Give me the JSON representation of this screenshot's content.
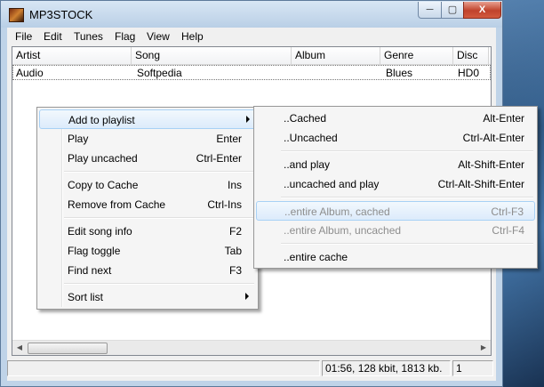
{
  "window": {
    "title": "MP3STOCK"
  },
  "caption_buttons": {
    "minimize": "─",
    "maximize": "▢",
    "close": "X"
  },
  "menubar": [
    "File",
    "Edit",
    "Tunes",
    "Flag",
    "View",
    "Help"
  ],
  "columns": [
    "Artist",
    "Song",
    "Album",
    "Genre",
    "Disc"
  ],
  "rows": [
    {
      "artist": "Audio",
      "song": "Softpedia",
      "album": "",
      "genre": "Blues",
      "disc": "HD0"
    }
  ],
  "context_menu": [
    {
      "label": "Add to playlist",
      "shortcut": "",
      "submenu": true,
      "highlighted": true
    },
    {
      "label": "Play",
      "shortcut": "Enter"
    },
    {
      "label": "Play uncached",
      "shortcut": "Ctrl-Enter"
    },
    {
      "label": "Copy to Cache",
      "shortcut": "Ins"
    },
    {
      "label": "Remove from Cache",
      "shortcut": "Ctrl-Ins"
    },
    {
      "label": "Edit song info",
      "shortcut": "F2"
    },
    {
      "label": "Flag toggle",
      "shortcut": "Tab"
    },
    {
      "label": "Find next",
      "shortcut": "F3"
    },
    {
      "label": "Sort list",
      "shortcut": "",
      "submenu": true
    }
  ],
  "submenu": [
    {
      "label": "..Cached",
      "shortcut": "Alt-Enter"
    },
    {
      "label": "..Uncached",
      "shortcut": "Ctrl-Alt-Enter"
    },
    {
      "label": "..and play",
      "shortcut": "Alt-Shift-Enter"
    },
    {
      "label": "..uncached and play",
      "shortcut": "Ctrl-Alt-Shift-Enter"
    },
    {
      "label": "..entire Album, cached",
      "shortcut": "Ctrl-F3",
      "disabled": true,
      "highlighted": true
    },
    {
      "label": "..entire Album, uncached",
      "shortcut": "Ctrl-F4",
      "disabled": true
    },
    {
      "label": "..entire cache",
      "shortcut": ""
    }
  ],
  "status": {
    "info": "01:56, 128 kbit, 1813 kb.",
    "count": "1"
  }
}
